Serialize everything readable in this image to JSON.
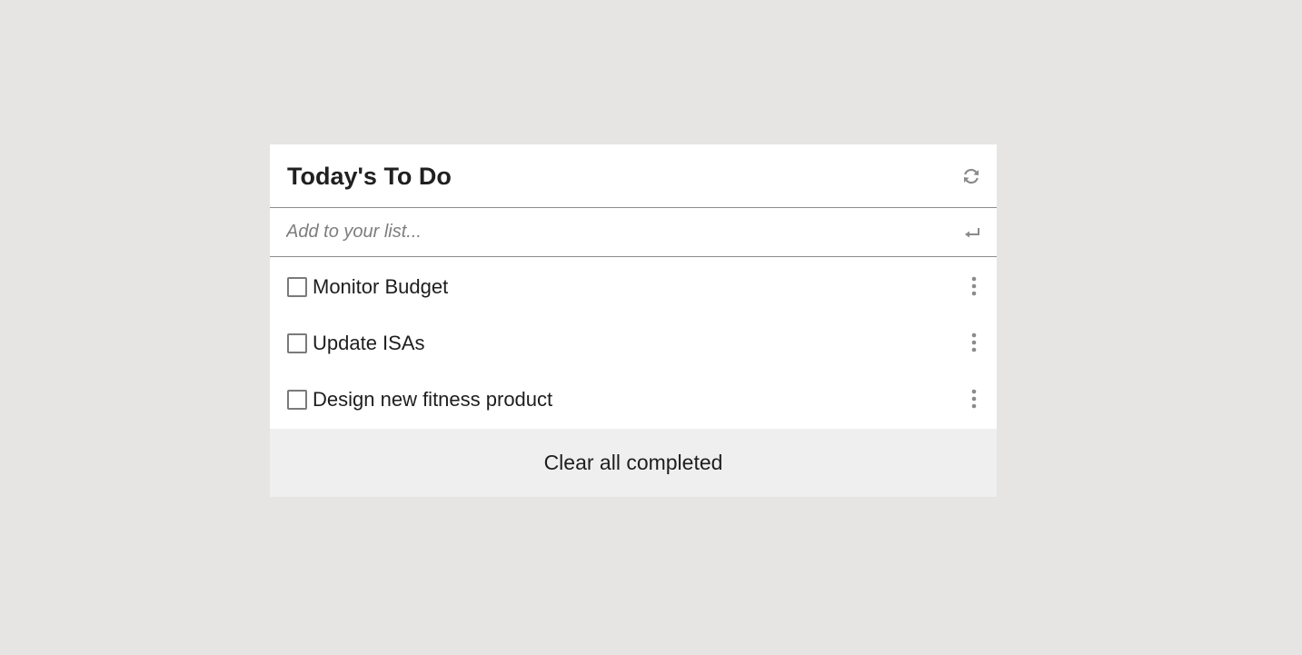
{
  "card": {
    "title": "Today's To Do"
  },
  "add": {
    "placeholder": "Add to your list...",
    "value": ""
  },
  "items": [
    {
      "label": "Monitor Budget",
      "checked": false
    },
    {
      "label": "Update ISAs",
      "checked": false
    },
    {
      "label": "Design new fitness product",
      "checked": false
    }
  ],
  "footer": {
    "clear_label": "Clear all completed"
  },
  "icons": {
    "refresh": "refresh-icon",
    "enter": "enter-icon",
    "menu": "more-vertical-icon"
  },
  "colors": {
    "background": "#e6e5e3",
    "card": "#ffffff",
    "footer": "#efefef",
    "divider": "#8c8c8c",
    "icon": "#8a8a8a"
  }
}
